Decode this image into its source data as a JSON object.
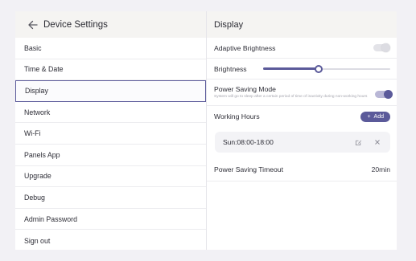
{
  "sidebar": {
    "title": "Device Settings",
    "items": [
      {
        "label": "Basic"
      },
      {
        "label": "Time & Date"
      },
      {
        "label": "Display",
        "active": true
      },
      {
        "label": "Network"
      },
      {
        "label": "Wi-Fi"
      },
      {
        "label": "Panels App"
      },
      {
        "label": "Upgrade"
      },
      {
        "label": "Debug"
      },
      {
        "label": "Admin Password"
      },
      {
        "label": "Sign out"
      }
    ]
  },
  "main": {
    "title": "Display",
    "adaptive_brightness": {
      "label": "Adaptive Brightness",
      "enabled": false
    },
    "brightness": {
      "label": "Brightness",
      "level": 0.43
    },
    "power_saving": {
      "label": "Power Saving Mode",
      "description": "System will go to sleep after a certain period of time of inactivity during non-working hours",
      "enabled": true
    },
    "working_hours": {
      "label": "Working Hours",
      "add_label": "Add",
      "schedules": [
        {
          "text": "Sun:08:00-18:00"
        }
      ]
    },
    "timeout": {
      "label": "Power Saving Timeout",
      "value": "20min"
    }
  },
  "icons": {
    "back": "arrow-left-icon",
    "add": "plus-icon",
    "edit": "edit-icon",
    "delete": "close-icon"
  },
  "colors": {
    "accent": "#5b5a9a",
    "background": "#f2f1f5",
    "header": "#f5f4f2"
  }
}
